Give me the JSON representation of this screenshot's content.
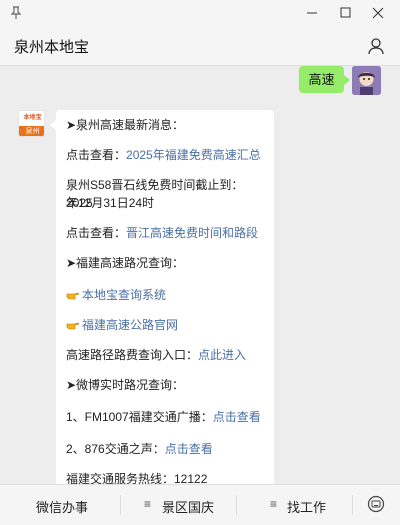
{
  "app": {
    "title": "泉州本地宝"
  },
  "window_controls": {
    "pin": "pin-icon",
    "minimize": "minimize-icon",
    "maximize": "maximize-icon",
    "close": "close-icon"
  },
  "header": {
    "title": "泉州本地宝",
    "profile_icon": "user-icon"
  },
  "chat": {
    "user_message": "高速",
    "bot_avatar": {
      "top_text": "本地宝",
      "bottom_text": "泉州"
    },
    "reply": {
      "l1": "➤泉州高速最新消息：",
      "l2_prefix": "点击查看：",
      "l2_link": "2025年福建免费高速汇总",
      "l3a": "泉州S58晋石线免费时间截止到：2025",
      "l3b": "年12月31日24时",
      "l4_prefix": "点击查看：",
      "l4_link": "晋江高速免费时间和路段",
      "l5": "➤福建高速路况查询：",
      "l6_link": "本地宝查询系统",
      "l7_link": "福建高速公路官网",
      "l8_prefix": "高速路径路费查询入口：",
      "l8_link": "点此进入",
      "l9": "➤微博实时路况查询：",
      "l10_prefix": "1、FM1007福建交通广播：",
      "l10_link": "点击查看",
      "l11_prefix": "2、876交通之声：",
      "l11_link": "点击查看",
      "l12": "福建交通服务热线：12122"
    }
  },
  "bottom_menu": {
    "item1": "微信办事",
    "item2": "景区国庆",
    "item3": "找工作",
    "menu_glyph": "≡",
    "keyboard_icon": "keyboard-icon"
  }
}
